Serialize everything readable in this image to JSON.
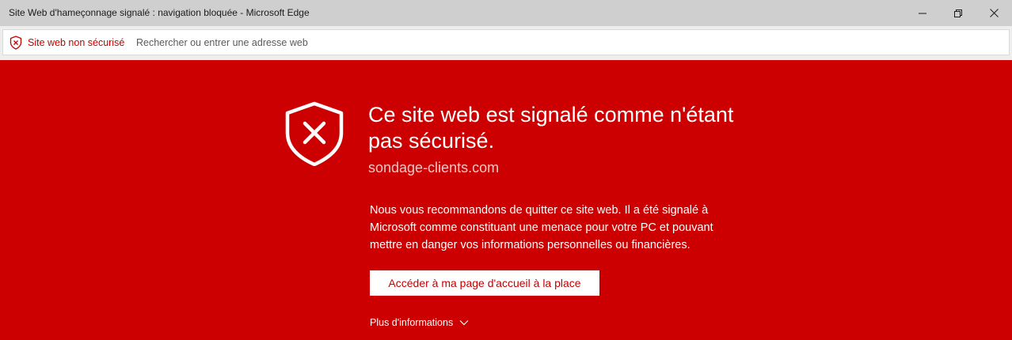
{
  "window": {
    "title": "Site Web d'hameçonnage signalé : navigation bloquée - Microsoft Edge",
    "controls": {
      "minimize": "minimize-icon",
      "restore": "restore-icon",
      "close": "close-icon"
    }
  },
  "address_bar": {
    "security_icon": "shield-x-icon",
    "security_status": "Site web non sécurisé",
    "placeholder": "Rechercher ou entrer une adresse web"
  },
  "warning": {
    "icon": "shield-x-icon",
    "headline": "Ce site web est signalé comme n'étant pas sécurisé.",
    "domain": "sondage-clients.com",
    "body": "Nous vous recommandons de quitter ce site web. Il a été signalé à Microsoft comme constituant une menace pour votre PC et pouvant mettre en danger vos informations personnelles ou financières.",
    "home_button_label": "Accéder à ma page d'accueil à la place",
    "more_info_label": "Plus d'informations"
  },
  "colors": {
    "warning_background": "#cc0000",
    "titlebar": "#cfcfcf",
    "status_red": "#c40000",
    "text_white": "#ffffff"
  }
}
